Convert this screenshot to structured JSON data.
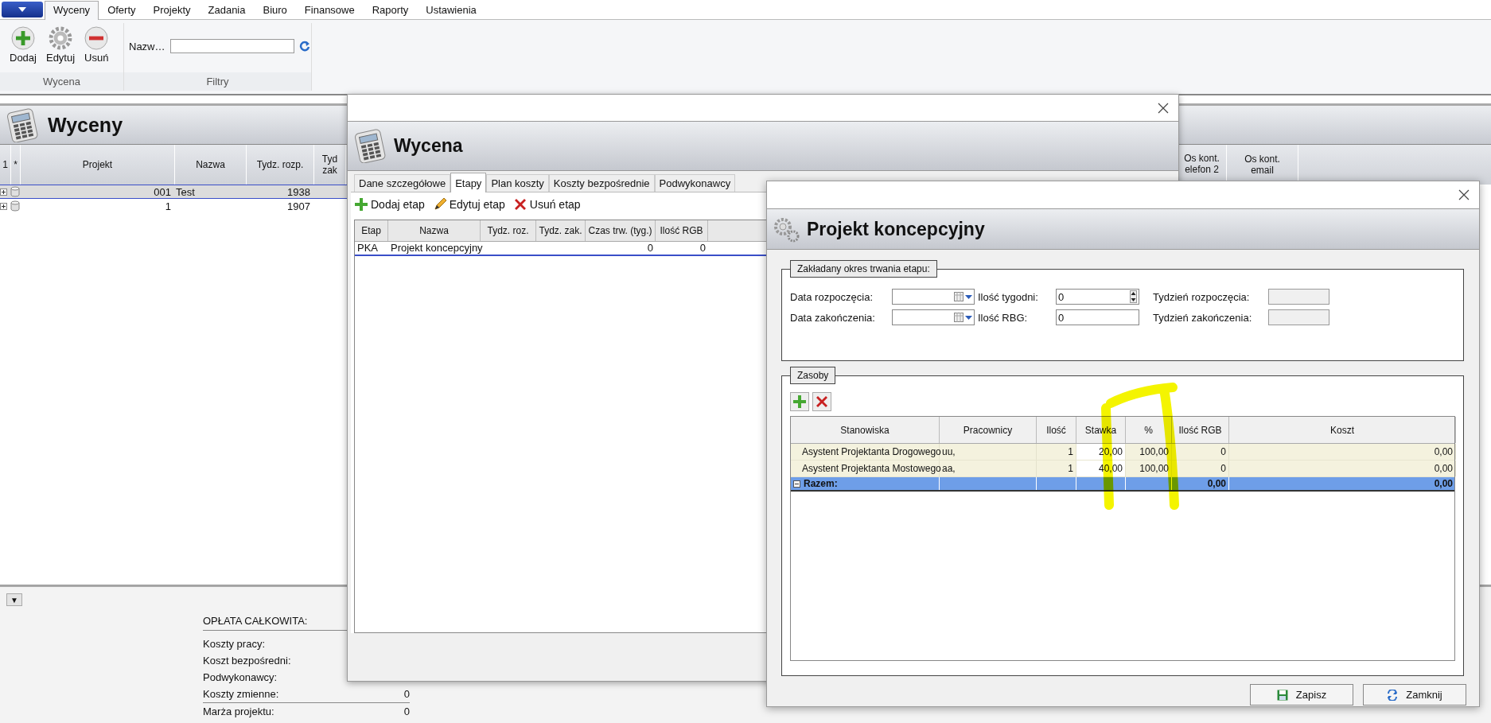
{
  "ribbon": {
    "tabs": [
      {
        "label": "Wyceny",
        "selected": true
      },
      {
        "label": "Oferty",
        "selected": false
      },
      {
        "label": "Projekty",
        "selected": false
      },
      {
        "label": "Zadania",
        "selected": false
      },
      {
        "label": "Biuro",
        "selected": false
      },
      {
        "label": "Finansowe",
        "selected": false
      },
      {
        "label": "Raporty",
        "selected": false
      },
      {
        "label": "Ustawienia",
        "selected": false
      }
    ],
    "groups": [
      {
        "label": "Wycena",
        "buttons": [
          {
            "label": "Dodaj",
            "kind": "add"
          },
          {
            "label": "Edytuj",
            "kind": "edit"
          },
          {
            "label": "Usuń",
            "kind": "delete"
          }
        ]
      },
      {
        "label": "Filtry",
        "filter_label": "Nazw…"
      }
    ]
  },
  "main": {
    "title": "Wyceny",
    "columns": [
      "1",
      "*",
      "Projekt",
      "Nazwa",
      "Tydz. rozp.",
      "Tyd zak",
      "Os kont. elefon 2",
      "Os kont. email"
    ],
    "rows": [
      {
        "projekt": "001",
        "nazwa": "Test",
        "tydz_rozp": "1938",
        "selected": true
      },
      {
        "projekt": "1",
        "tydz_rozp": "1907",
        "selected": false
      }
    ]
  },
  "summary": {
    "collapse_button": "▼",
    "heading": "OPŁATA CAŁKOWITA:",
    "lines": [
      {
        "label": "Koszty pracy:"
      },
      {
        "label": "Koszt bezpośredni:"
      },
      {
        "label": "Podwykonawcy:"
      },
      {
        "label": "Koszty zmienne:",
        "value": "0"
      }
    ],
    "margin": {
      "label": "Marża projektu:",
      "value": "0"
    }
  },
  "estimate_dialog": {
    "title": "Wycena",
    "tabs": [
      {
        "label": "Dane szczegółowe",
        "selected": false
      },
      {
        "label": "Etapy",
        "selected": true
      },
      {
        "label": "Plan koszty",
        "selected": false
      },
      {
        "label": "Koszty bezpośrednie",
        "selected": false
      },
      {
        "label": "Podwykonawcy",
        "selected": false
      }
    ],
    "toolbar": [
      {
        "label": "Dodaj etap",
        "kind": "add"
      },
      {
        "label": "Edytuj etap",
        "kind": "edit"
      },
      {
        "label": "Usuń etap",
        "kind": "delete"
      }
    ],
    "columns": [
      "Etap",
      "Nazwa",
      "Tydz. roz.",
      "Tydz. zak.",
      "Czas trw. (tyg.)",
      "Ilość RGB"
    ],
    "rows": [
      {
        "etap": "PKA",
        "nazwa": "Projekt koncepcyjny",
        "czas": "0",
        "rgb": "0",
        "selected": true
      }
    ]
  },
  "stage_dialog": {
    "title": "Projekt koncepcyjny",
    "period_group": {
      "title": "Zakładany okres trwania etapu:",
      "fields": [
        {
          "label": "Data rozpoczęcia:",
          "kind": "date"
        },
        {
          "label": "Ilość tygodni:",
          "kind": "spinner",
          "value": "0"
        },
        {
          "label": "Tydzień rozpoczęcia:",
          "kind": "readonly"
        },
        {
          "label": "Data zakończenia:",
          "kind": "date"
        },
        {
          "label": "Ilość RBG:",
          "kind": "text",
          "value": "0"
        },
        {
          "label": "Tydzień zakończenia:",
          "kind": "readonly"
        }
      ]
    },
    "resources_group": {
      "title": "Zasoby",
      "columns": [
        "Stanowiska",
        "Pracownicy",
        "Ilość",
        "Stawka",
        "%",
        "Ilość RGB",
        "Koszt"
      ],
      "rows": [
        {
          "cells": [
            "Asystent Projektanta Drogowego",
            "uu,",
            "1",
            "20,00",
            "100,00",
            "0",
            "0,00"
          ]
        },
        {
          "cells": [
            "Asystent Projektanta Mostowego",
            "aa,",
            "1",
            "40,00",
            "100,00",
            "0",
            "0,00"
          ]
        }
      ],
      "total": {
        "label": "Razem:",
        "expanded": true,
        "rgb": "0,00",
        "cost": "0,00"
      }
    },
    "buttons": [
      {
        "label": "Zapisz",
        "kind": "save"
      },
      {
        "label": "Zamknij",
        "kind": "close"
      }
    ]
  }
}
